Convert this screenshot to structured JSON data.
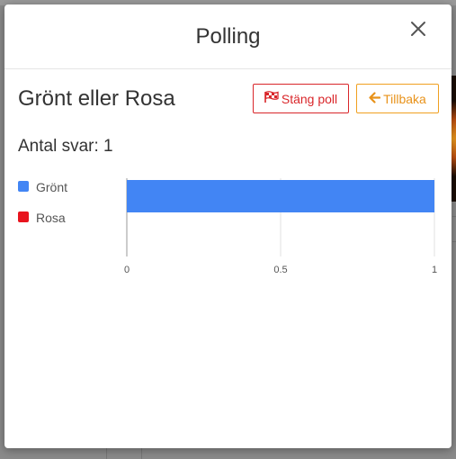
{
  "modal": {
    "title": "Polling",
    "close_icon": "close-icon"
  },
  "poll": {
    "title": "Grönt eller Rosa",
    "answer_count": "Antal svar: 1"
  },
  "buttons": {
    "close_poll_label": "Stäng poll",
    "close_poll_icon": "flag-checkered-icon",
    "close_poll_color": "#d9262a",
    "back_label": "Tillbaka",
    "back_icon": "arrow-left-icon",
    "back_color": "#f0a020"
  },
  "chart_data": {
    "type": "bar",
    "orientation": "horizontal",
    "categories": [
      "Grönt",
      "Rosa"
    ],
    "series": [
      {
        "values": [
          1,
          0
        ],
        "colors": [
          "#4285f4",
          "#e8141e"
        ]
      }
    ],
    "xlim": [
      0,
      1
    ],
    "x_ticks": [
      "0",
      "0.5",
      "1"
    ],
    "legend": [
      {
        "label": "Grönt",
        "color": "#4285f4"
      },
      {
        "label": "Rosa",
        "color": "#e8141e"
      }
    ],
    "legend_position": "left",
    "grid": true
  }
}
